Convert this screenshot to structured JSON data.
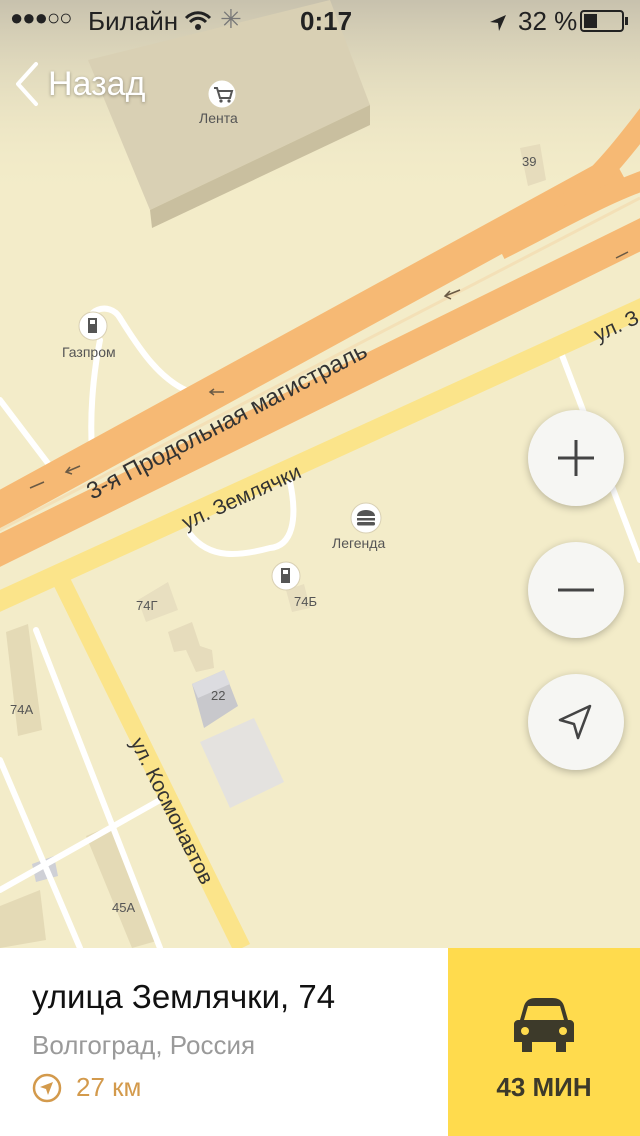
{
  "statusbar": {
    "carrier": "Билайн",
    "time": "0:17",
    "battery": "32 %"
  },
  "nav": {
    "back_label": "Назад"
  },
  "map": {
    "pois": [
      {
        "name": "Лента",
        "icon": "cart-icon"
      },
      {
        "name": "Газпром",
        "icon": "fuel-icon"
      },
      {
        "name": "Легенда",
        "icon": "burger-icon"
      },
      {
        "name": "",
        "icon": "fuel-icon"
      }
    ],
    "streets": {
      "highway": "3-я Продольная магистраль",
      "zemlyachki": "ул. Землячки",
      "zemlyachki_short": "ул. З",
      "kosmonavtov": "ул. Космонавтов"
    },
    "buildings": [
      "39",
      "74Г",
      "74Б",
      "22",
      "74А",
      "45А"
    ]
  },
  "controls": {
    "zoom_in": "plus-icon",
    "zoom_out": "minus-icon",
    "locate": "navigation-arrow-icon"
  },
  "place": {
    "title": "улица Землячки, 74",
    "subtitle": "Волгоград, Россия",
    "distance": "27 км"
  },
  "route": {
    "time": "43 МИН",
    "icon": "car-icon"
  },
  "colors": {
    "map_bg": "#f3ecc9",
    "road_major": "#f6b974",
    "road_minor": "#fbe48a",
    "route_button": "#ffdb4d",
    "accent_distance": "#d39a4c"
  }
}
